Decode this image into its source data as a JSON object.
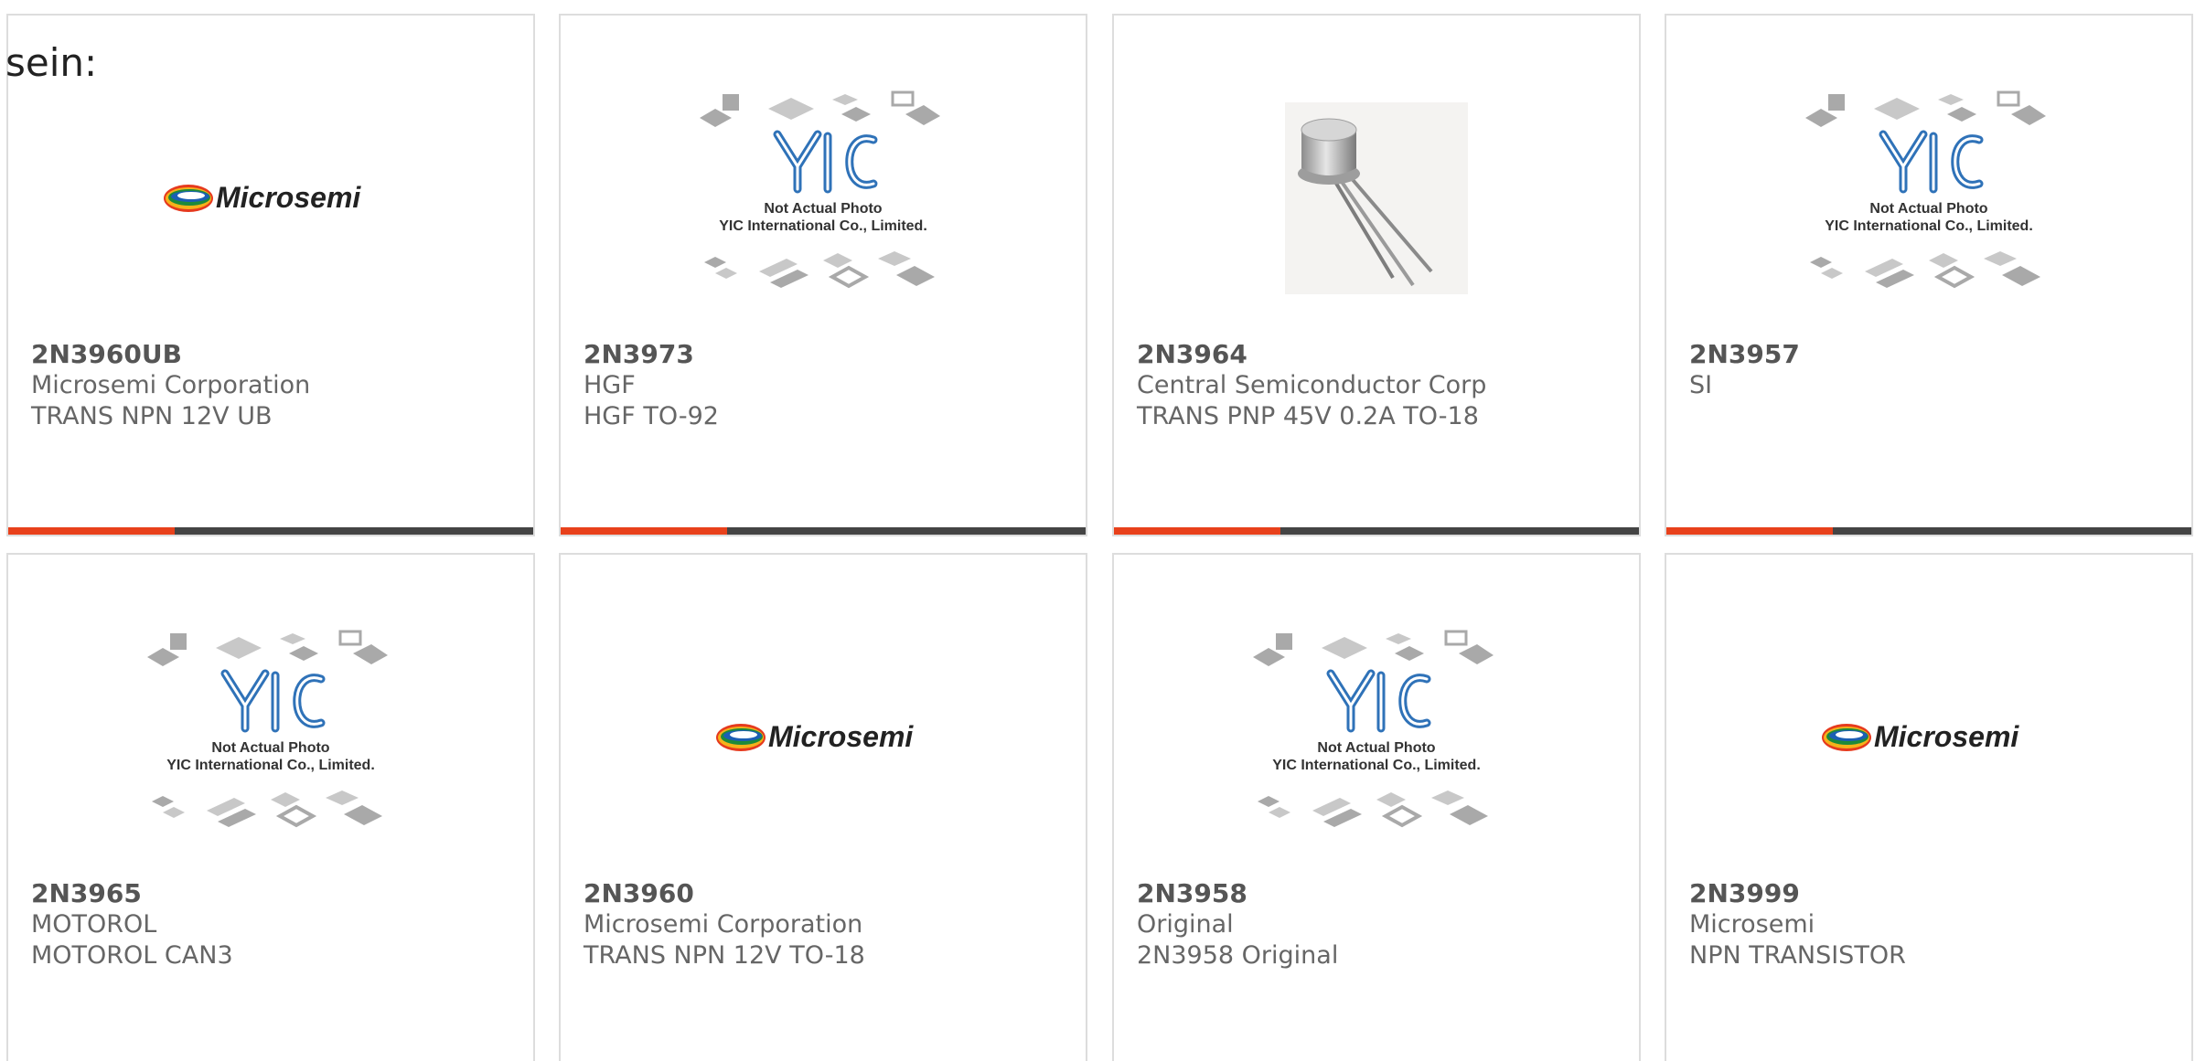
{
  "lead_text": "sein:",
  "colors": {
    "accent": "#e8411b",
    "bar": "#444444",
    "text_bold": "#555555",
    "text": "#666666"
  },
  "products": [
    {
      "part_number": "2N3960UB",
      "manufacturer": "Microsemi Corporation",
      "description": "TRANS NPN 12V UB",
      "image": "microsemi-logo",
      "logo_text": "Microsemi"
    },
    {
      "part_number": "2N3973",
      "manufacturer": "HGF",
      "description": "HGF TO-92",
      "image": "yic-placeholder",
      "placeholder_line1": "Not Actual Photo",
      "placeholder_line2": "YIC International Co., Limited."
    },
    {
      "part_number": "2N3964",
      "manufacturer": "Central Semiconductor Corp",
      "description": "TRANS PNP 45V 0.2A TO-18",
      "image": "transistor-photo"
    },
    {
      "part_number": "2N3957",
      "manufacturer": "SI",
      "description": "",
      "image": "yic-placeholder",
      "placeholder_line1": "Not Actual Photo",
      "placeholder_line2": "YIC International Co., Limited."
    },
    {
      "part_number": "2N3965",
      "manufacturer": "MOTOROL",
      "description": "MOTOROL CAN3",
      "image": "yic-placeholder",
      "placeholder_line1": "Not Actual Photo",
      "placeholder_line2": "YIC International Co., Limited."
    },
    {
      "part_number": "2N3960",
      "manufacturer": "Microsemi Corporation",
      "description": "TRANS NPN 12V TO-18",
      "image": "microsemi-logo",
      "logo_text": "Microsemi"
    },
    {
      "part_number": "2N3958",
      "manufacturer": "Original",
      "description": "2N3958 Original",
      "image": "yic-placeholder",
      "placeholder_line1": "Not Actual Photo",
      "placeholder_line2": "YIC International Co., Limited."
    },
    {
      "part_number": "2N3999",
      "manufacturer": "Microsemi",
      "description": "NPN TRANSISTOR",
      "image": "microsemi-logo",
      "logo_text": "Microsemi"
    }
  ]
}
